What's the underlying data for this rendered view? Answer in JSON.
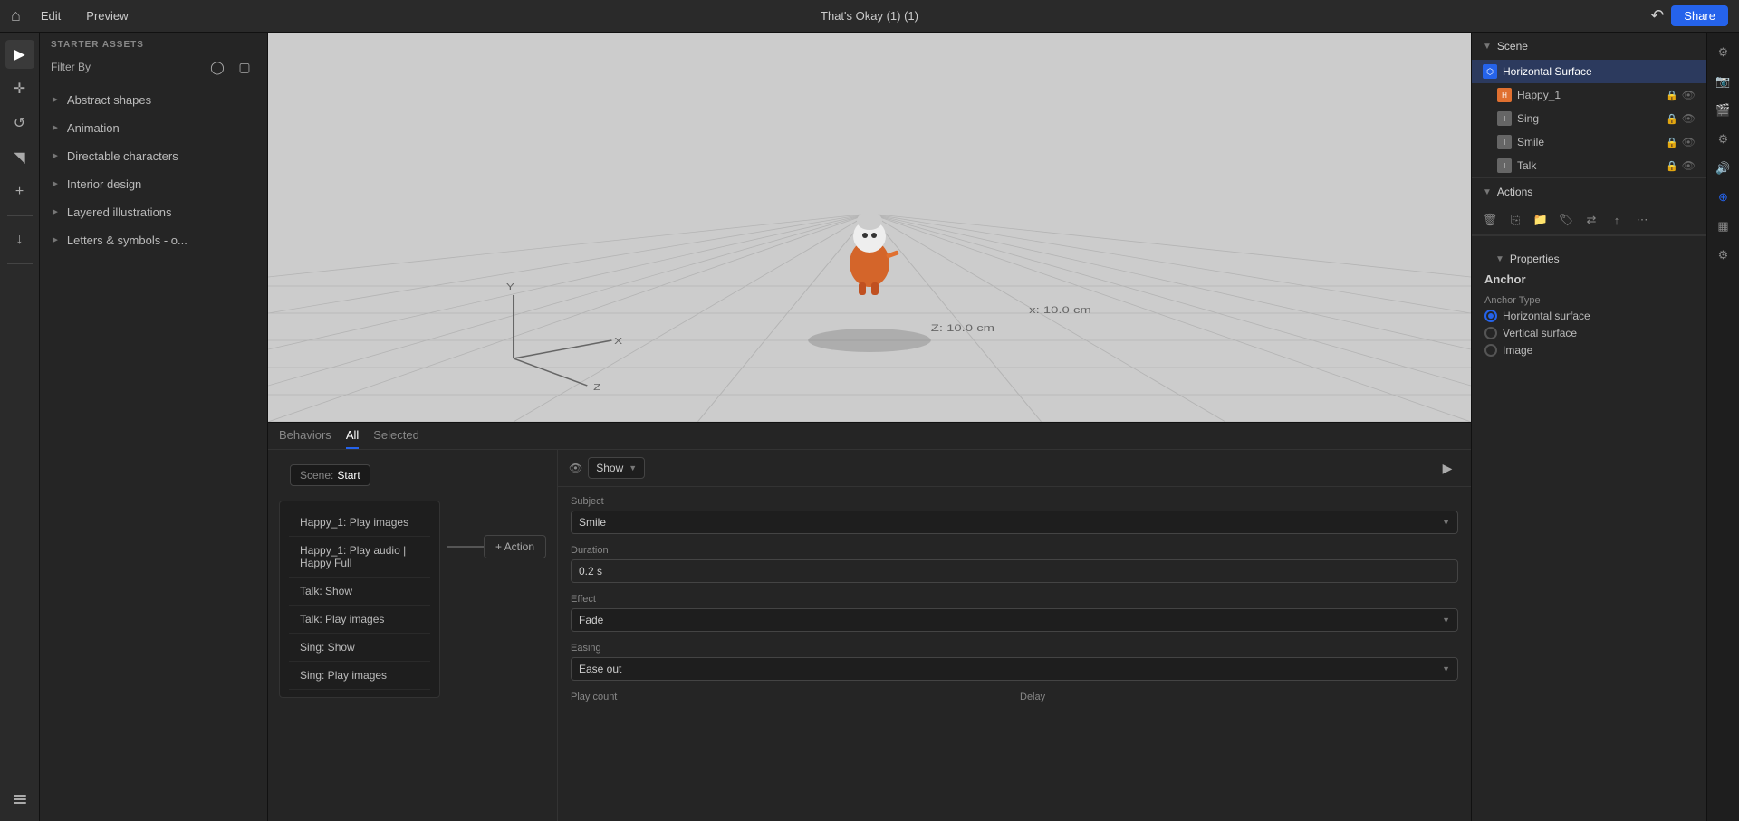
{
  "topbar": {
    "menu_items": [
      "Edit",
      "Preview"
    ],
    "title": "That's Okay (1) (1)",
    "share_label": "Share"
  },
  "sidebar": {
    "header": "STARTER ASSETS",
    "filter_label": "Filter By",
    "categories": [
      {
        "id": "abstract-shapes",
        "label": "Abstract shapes"
      },
      {
        "id": "animation",
        "label": "Animation"
      },
      {
        "id": "directable-characters",
        "label": "Directable characters"
      },
      {
        "id": "interior-design",
        "label": "Interior design"
      },
      {
        "id": "layered-illustrations",
        "label": "Layered illustrations"
      },
      {
        "id": "letters-symbols",
        "label": "Letters & symbols - o..."
      }
    ]
  },
  "bottom_tabs": [
    {
      "id": "behaviors",
      "label": "Behaviors"
    },
    {
      "id": "all",
      "label": "All"
    },
    {
      "id": "selected",
      "label": "Selected"
    }
  ],
  "scene_start": {
    "label": "Scene:",
    "value": "Start"
  },
  "actions": [
    {
      "id": 1,
      "label": "Happy_1: Play images"
    },
    {
      "id": 2,
      "label": "Happy_1: Play audio | Happy Full"
    },
    {
      "id": 3,
      "label": "Talk:  Show"
    },
    {
      "id": 4,
      "label": "Talk:  Play images"
    },
    {
      "id": 5,
      "label": "Sing:  Show"
    },
    {
      "id": 6,
      "label": "Sing:  Play images"
    }
  ],
  "add_action_label": "+ Action",
  "action_details": {
    "show_dropdown": "Show",
    "subject_label": "Subject",
    "subject_value": "Smile",
    "duration_label": "Duration",
    "duration_value": "0.2 s",
    "effect_label": "Effect",
    "effect_value": "Fade",
    "easing_label": "Easing",
    "easing_value": "Ease out",
    "play_count_label": "Play count",
    "delay_label": "Delay"
  },
  "scene_panel": {
    "title": "Scene",
    "items": [
      {
        "id": "horizontal-surface",
        "label": "Horizontal Surface",
        "type": "surface",
        "active": true
      },
      {
        "id": "happy1",
        "label": "Happy_1",
        "type": "char",
        "indent": true
      },
      {
        "id": "sing",
        "label": "Sing",
        "type": "image",
        "indent": true
      },
      {
        "id": "smile",
        "label": "Smile",
        "type": "image",
        "indent": true
      },
      {
        "id": "talk",
        "label": "Talk",
        "type": "image",
        "indent": true
      }
    ]
  },
  "actions_panel": {
    "title": "Actions"
  },
  "properties_panel": {
    "title": "Properties",
    "anchor_title": "Anchor",
    "anchor_type_label": "Anchor Type",
    "anchor_type_options": [
      {
        "id": "horizontal-surface",
        "label": "Horizontal surface",
        "selected": true
      },
      {
        "id": "vertical-surface",
        "label": "Vertical surface",
        "selected": false
      },
      {
        "id": "image",
        "label": "Image",
        "selected": false
      }
    ]
  },
  "viewport": {
    "coord_z": "Z: 10.0 cm",
    "coord_x": "x: 10.0 cm"
  }
}
